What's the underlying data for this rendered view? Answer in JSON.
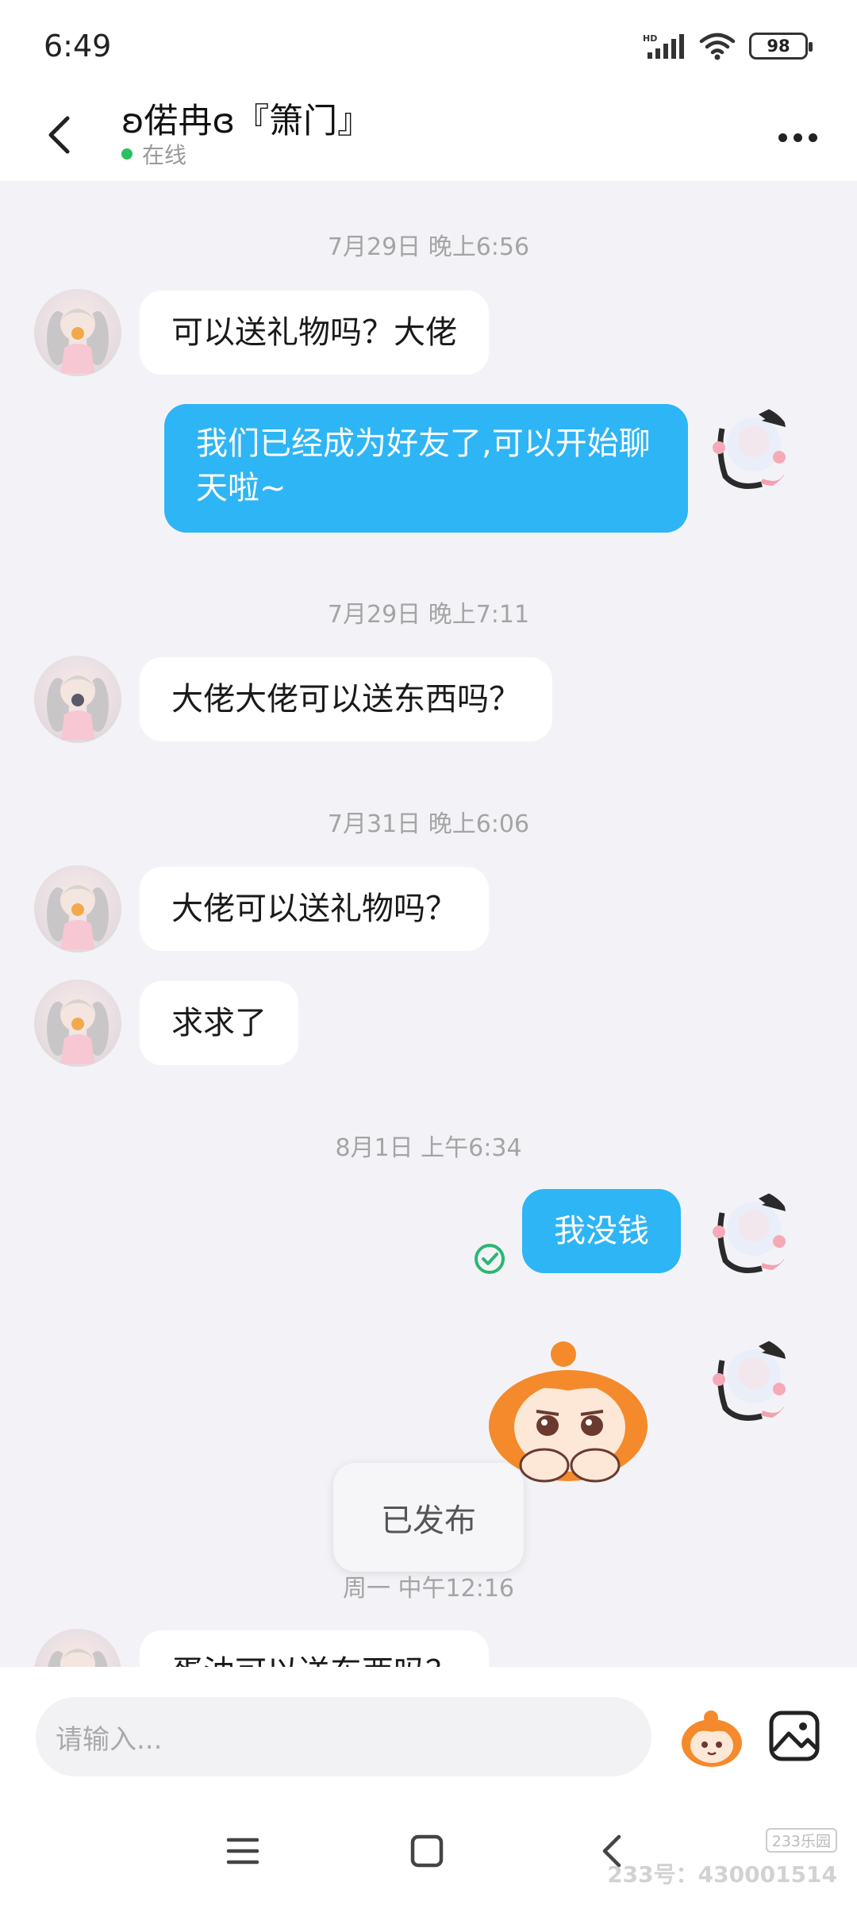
{
  "status_bar": {
    "time": "6:49",
    "battery": "98",
    "network_badge": "HD"
  },
  "header": {
    "title": "ʚ偌冉ɞ『箫门』",
    "status": "在线"
  },
  "messages": [
    {
      "type": "timestamp",
      "text": "7月29日 晚上6:56"
    },
    {
      "type": "incoming",
      "text": "可以送礼物吗？大佬"
    },
    {
      "type": "outgoing",
      "text": "我们已经成为好友了,可以开始聊天啦~"
    },
    {
      "type": "timestamp",
      "text": "7月29日 晚上7:11"
    },
    {
      "type": "incoming",
      "text": "大佬大佬可以送东西吗？"
    },
    {
      "type": "timestamp",
      "text": "7月31日 晚上6:06"
    },
    {
      "type": "incoming",
      "text": "大佬可以送礼物吗？"
    },
    {
      "type": "incoming",
      "text": "求求了"
    },
    {
      "type": "timestamp",
      "text": "8月1日 上午6:34"
    },
    {
      "type": "outgoing",
      "text": "我没钱"
    },
    {
      "type": "outgoing_sticker",
      "text": ""
    },
    {
      "type": "timestamp",
      "text": "周一 中午12:16"
    },
    {
      "type": "incoming",
      "text": "蛋油可以送东西吗？"
    }
  ],
  "toast": {
    "text": "已发布"
  },
  "input": {
    "placeholder": "请输入..."
  },
  "watermark": {
    "logo": "233乐园",
    "id": "233号：430001514"
  },
  "colors": {
    "outgoing_bubble": "#2eb5f5",
    "online_dot": "#2ac15f",
    "chat_background": "#f3f3f7",
    "sent_check": "#2bb673"
  },
  "icons": [
    "back-arrow-icon",
    "more-dots-icon",
    "signal-icon",
    "wifi-icon",
    "battery-icon",
    "sent-check-icon",
    "emoji-sticker-icon",
    "image-icon",
    "menu-icon",
    "home-icon",
    "back-nav-icon"
  ]
}
